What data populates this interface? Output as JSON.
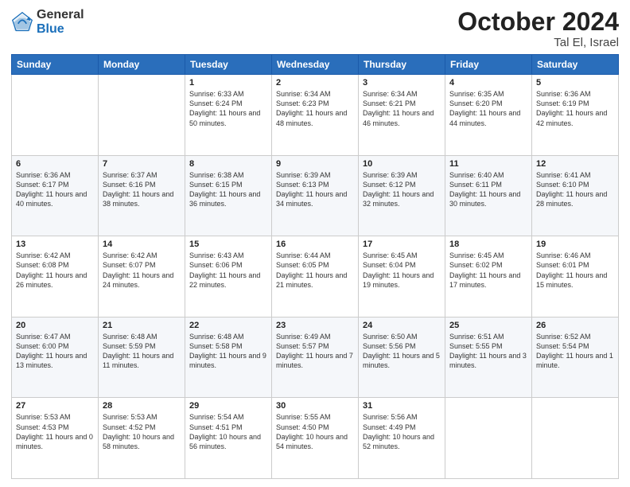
{
  "header": {
    "logo_general": "General",
    "logo_blue": "Blue",
    "month_title": "October 2024",
    "location": "Tal El, Israel"
  },
  "days_of_week": [
    "Sunday",
    "Monday",
    "Tuesday",
    "Wednesday",
    "Thursday",
    "Friday",
    "Saturday"
  ],
  "weeks": [
    [
      {
        "day": "",
        "sunrise": "",
        "sunset": "",
        "daylight": ""
      },
      {
        "day": "",
        "sunrise": "",
        "sunset": "",
        "daylight": ""
      },
      {
        "day": "1",
        "sunrise": "Sunrise: 6:33 AM",
        "sunset": "Sunset: 6:24 PM",
        "daylight": "Daylight: 11 hours and 50 minutes."
      },
      {
        "day": "2",
        "sunrise": "Sunrise: 6:34 AM",
        "sunset": "Sunset: 6:23 PM",
        "daylight": "Daylight: 11 hours and 48 minutes."
      },
      {
        "day": "3",
        "sunrise": "Sunrise: 6:34 AM",
        "sunset": "Sunset: 6:21 PM",
        "daylight": "Daylight: 11 hours and 46 minutes."
      },
      {
        "day": "4",
        "sunrise": "Sunrise: 6:35 AM",
        "sunset": "Sunset: 6:20 PM",
        "daylight": "Daylight: 11 hours and 44 minutes."
      },
      {
        "day": "5",
        "sunrise": "Sunrise: 6:36 AM",
        "sunset": "Sunset: 6:19 PM",
        "daylight": "Daylight: 11 hours and 42 minutes."
      }
    ],
    [
      {
        "day": "6",
        "sunrise": "Sunrise: 6:36 AM",
        "sunset": "Sunset: 6:17 PM",
        "daylight": "Daylight: 11 hours and 40 minutes."
      },
      {
        "day": "7",
        "sunrise": "Sunrise: 6:37 AM",
        "sunset": "Sunset: 6:16 PM",
        "daylight": "Daylight: 11 hours and 38 minutes."
      },
      {
        "day": "8",
        "sunrise": "Sunrise: 6:38 AM",
        "sunset": "Sunset: 6:15 PM",
        "daylight": "Daylight: 11 hours and 36 minutes."
      },
      {
        "day": "9",
        "sunrise": "Sunrise: 6:39 AM",
        "sunset": "Sunset: 6:13 PM",
        "daylight": "Daylight: 11 hours and 34 minutes."
      },
      {
        "day": "10",
        "sunrise": "Sunrise: 6:39 AM",
        "sunset": "Sunset: 6:12 PM",
        "daylight": "Daylight: 11 hours and 32 minutes."
      },
      {
        "day": "11",
        "sunrise": "Sunrise: 6:40 AM",
        "sunset": "Sunset: 6:11 PM",
        "daylight": "Daylight: 11 hours and 30 minutes."
      },
      {
        "day": "12",
        "sunrise": "Sunrise: 6:41 AM",
        "sunset": "Sunset: 6:10 PM",
        "daylight": "Daylight: 11 hours and 28 minutes."
      }
    ],
    [
      {
        "day": "13",
        "sunrise": "Sunrise: 6:42 AM",
        "sunset": "Sunset: 6:08 PM",
        "daylight": "Daylight: 11 hours and 26 minutes."
      },
      {
        "day": "14",
        "sunrise": "Sunrise: 6:42 AM",
        "sunset": "Sunset: 6:07 PM",
        "daylight": "Daylight: 11 hours and 24 minutes."
      },
      {
        "day": "15",
        "sunrise": "Sunrise: 6:43 AM",
        "sunset": "Sunset: 6:06 PM",
        "daylight": "Daylight: 11 hours and 22 minutes."
      },
      {
        "day": "16",
        "sunrise": "Sunrise: 6:44 AM",
        "sunset": "Sunset: 6:05 PM",
        "daylight": "Daylight: 11 hours and 21 minutes."
      },
      {
        "day": "17",
        "sunrise": "Sunrise: 6:45 AM",
        "sunset": "Sunset: 6:04 PM",
        "daylight": "Daylight: 11 hours and 19 minutes."
      },
      {
        "day": "18",
        "sunrise": "Sunrise: 6:45 AM",
        "sunset": "Sunset: 6:02 PM",
        "daylight": "Daylight: 11 hours and 17 minutes."
      },
      {
        "day": "19",
        "sunrise": "Sunrise: 6:46 AM",
        "sunset": "Sunset: 6:01 PM",
        "daylight": "Daylight: 11 hours and 15 minutes."
      }
    ],
    [
      {
        "day": "20",
        "sunrise": "Sunrise: 6:47 AM",
        "sunset": "Sunset: 6:00 PM",
        "daylight": "Daylight: 11 hours and 13 minutes."
      },
      {
        "day": "21",
        "sunrise": "Sunrise: 6:48 AM",
        "sunset": "Sunset: 5:59 PM",
        "daylight": "Daylight: 11 hours and 11 minutes."
      },
      {
        "day": "22",
        "sunrise": "Sunrise: 6:48 AM",
        "sunset": "Sunset: 5:58 PM",
        "daylight": "Daylight: 11 hours and 9 minutes."
      },
      {
        "day": "23",
        "sunrise": "Sunrise: 6:49 AM",
        "sunset": "Sunset: 5:57 PM",
        "daylight": "Daylight: 11 hours and 7 minutes."
      },
      {
        "day": "24",
        "sunrise": "Sunrise: 6:50 AM",
        "sunset": "Sunset: 5:56 PM",
        "daylight": "Daylight: 11 hours and 5 minutes."
      },
      {
        "day": "25",
        "sunrise": "Sunrise: 6:51 AM",
        "sunset": "Sunset: 5:55 PM",
        "daylight": "Daylight: 11 hours and 3 minutes."
      },
      {
        "day": "26",
        "sunrise": "Sunrise: 6:52 AM",
        "sunset": "Sunset: 5:54 PM",
        "daylight": "Daylight: 11 hours and 1 minute."
      }
    ],
    [
      {
        "day": "27",
        "sunrise": "Sunrise: 5:53 AM",
        "sunset": "Sunset: 4:53 PM",
        "daylight": "Daylight: 11 hours and 0 minutes."
      },
      {
        "day": "28",
        "sunrise": "Sunrise: 5:53 AM",
        "sunset": "Sunset: 4:52 PM",
        "daylight": "Daylight: 10 hours and 58 minutes."
      },
      {
        "day": "29",
        "sunrise": "Sunrise: 5:54 AM",
        "sunset": "Sunset: 4:51 PM",
        "daylight": "Daylight: 10 hours and 56 minutes."
      },
      {
        "day": "30",
        "sunrise": "Sunrise: 5:55 AM",
        "sunset": "Sunset: 4:50 PM",
        "daylight": "Daylight: 10 hours and 54 minutes."
      },
      {
        "day": "31",
        "sunrise": "Sunrise: 5:56 AM",
        "sunset": "Sunset: 4:49 PM",
        "daylight": "Daylight: 10 hours and 52 minutes."
      },
      {
        "day": "",
        "sunrise": "",
        "sunset": "",
        "daylight": ""
      },
      {
        "day": "",
        "sunrise": "",
        "sunset": "",
        "daylight": ""
      }
    ]
  ]
}
